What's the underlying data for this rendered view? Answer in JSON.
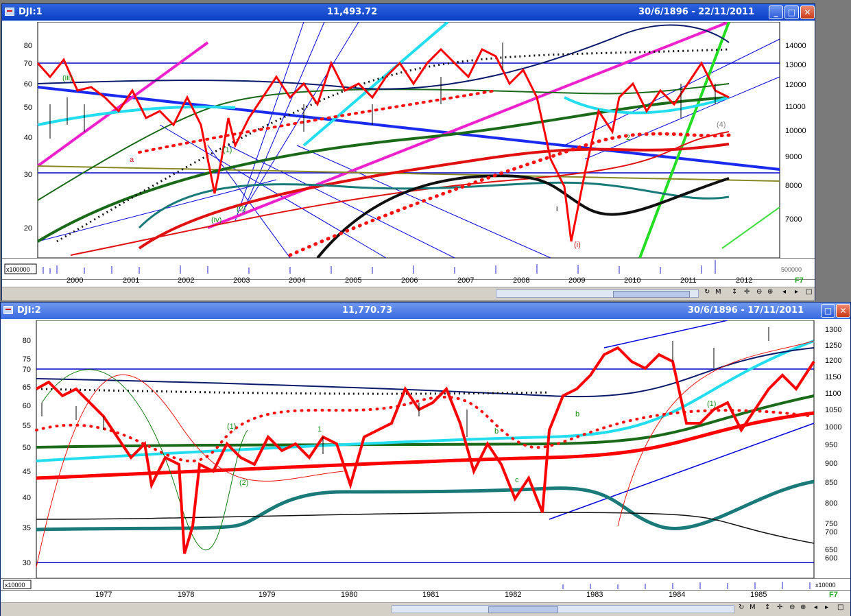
{
  "top_window": {
    "title": "DJI:1",
    "value": "11,493.72",
    "range": "30/6/1896 - 22/11/2011",
    "left_axis_ticks": [
      "80",
      "70",
      "60",
      "50",
      "40",
      "30",
      "20"
    ],
    "right_axis_ticks": [
      "14000",
      "13000",
      "12000",
      "11000",
      "10000",
      "9000",
      "8000",
      "7000"
    ],
    "volume_multiplier": "x100000",
    "volume_right_label": "500000",
    "years": [
      "2000",
      "2001",
      "2002",
      "2003",
      "2004",
      "2005",
      "2006",
      "2007",
      "2008",
      "2009",
      "2010",
      "2011",
      "2012"
    ],
    "wave_labels": [
      "(iii)",
      "(iv)",
      "(2)",
      "(1)",
      "a",
      "i",
      "(i)",
      "(4)",
      "2"
    ],
    "corner_badge": "F7"
  },
  "bottom_window": {
    "title": "DJI:2",
    "value": "11,770.73",
    "range": "30/6/1896 - 17/11/2011",
    "left_axis_ticks": [
      "80",
      "75",
      "70",
      "65",
      "60",
      "55",
      "50",
      "45",
      "40",
      "35",
      "30"
    ],
    "right_axis_ticks": [
      "1300",
      "1250",
      "1200",
      "1150",
      "1100",
      "1050",
      "1000",
      "950",
      "900",
      "850",
      "800",
      "750",
      "700",
      "650",
      "600"
    ],
    "volume_multiplier": "x10000",
    "volume_right_label": "x10000",
    "years": [
      "1977",
      "1978",
      "1979",
      "1980",
      "1981",
      "1982",
      "1983",
      "1984",
      "1985"
    ],
    "wave_labels": [
      "(1)",
      "(2)",
      "1",
      "b",
      "c",
      "(1)",
      "b"
    ],
    "corner_badge": "F7"
  },
  "toolbar": {
    "sync": "↻",
    "mode": "M",
    "updown": "↕",
    "move": "✛",
    "zoom_out": "⊖",
    "zoom_in": "⊕",
    "left": "◂",
    "right": "▸",
    "restore": "□"
  },
  "window_buttons": {
    "minimize": "_",
    "maximize": "□",
    "close": "✕"
  },
  "colors": {
    "title_blue": "#0a3fc4",
    "price_red": "#ff0000",
    "ma_teal": "#1a7a7a",
    "ma_green": "#1a6a1a",
    "cyan": "#33e0f0",
    "magenta": "#ff33cc",
    "lime": "#33dd22",
    "navy": "#0000cc"
  }
}
